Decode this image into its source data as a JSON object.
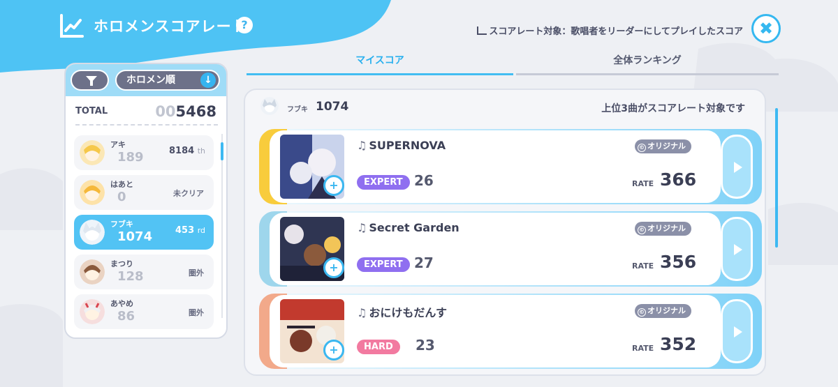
{
  "header": {
    "title": "ホロメンスコアレート",
    "help_label": "?",
    "target_note": "スコアレート対象：歌唱者をリーダーにしてプレイしたスコア",
    "close_label": "✖"
  },
  "tabs": [
    {
      "label": "マイスコア",
      "active": true
    },
    {
      "label": "全体ランキング",
      "active": false
    }
  ],
  "left_panel": {
    "sort_label": "ホロメン順",
    "sort_arrow": "↓",
    "total_label": "TOTAL",
    "total_prefix": "00",
    "total_value": "5468",
    "members": [
      {
        "name": "アキ",
        "score": "189",
        "rank": "8184",
        "rank_suffix": "th",
        "status": "",
        "selected": false
      },
      {
        "name": "はあと",
        "score": "0",
        "rank": "",
        "rank_suffix": "",
        "status": "未クリア",
        "selected": false
      },
      {
        "name": "フブキ",
        "score": "1074",
        "rank": "453",
        "rank_suffix": "rd",
        "status": "",
        "selected": true
      },
      {
        "name": "まつり",
        "score": "128",
        "rank": "",
        "rank_suffix": "",
        "status": "圏外",
        "selected": false
      },
      {
        "name": "あやめ",
        "score": "86",
        "rank": "",
        "rank_suffix": "",
        "status": "圏外",
        "selected": false
      }
    ]
  },
  "right_panel": {
    "char_name": "フブキ",
    "char_score": "1074",
    "top3_note": "上位3曲がスコアレート対象です",
    "songs": [
      {
        "title": "SUPERNOVA",
        "tag": "オリジナル",
        "difficulty": "EXPERT",
        "level": "26",
        "rate_label": "RATE",
        "rate": "366",
        "accent": "#f8cc3c",
        "diff_color": "#8f6ff0"
      },
      {
        "title": "Secret Garden",
        "tag": "オリジナル",
        "difficulty": "EXPERT",
        "level": "27",
        "rate_label": "RATE",
        "rate": "356",
        "accent": "#9ed6ec",
        "diff_color": "#8f6ff0"
      },
      {
        "title": "おにけもだんす",
        "tag": "オリジナル",
        "difficulty": "HARD",
        "level": "23",
        "rate_label": "RATE",
        "rate": "352",
        "accent": "#f2a98a",
        "diff_color": "#f27aa0"
      }
    ]
  }
}
